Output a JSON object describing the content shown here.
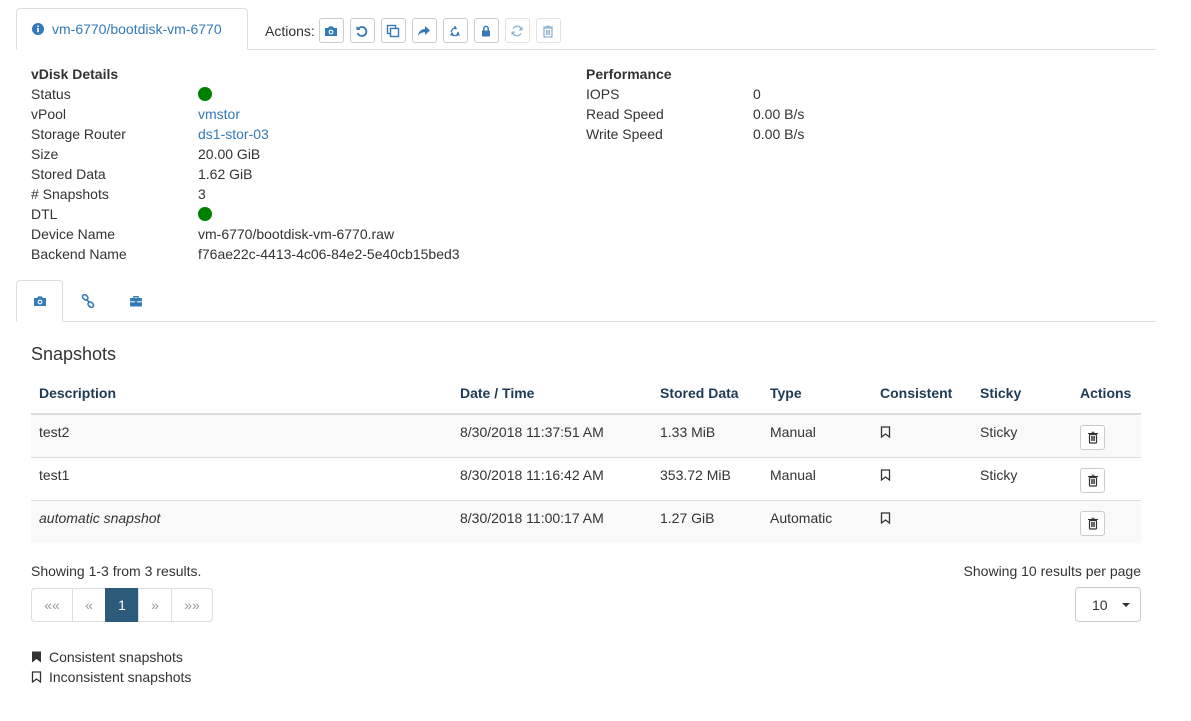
{
  "header": {
    "tab_title": "vm-6770/bootdisk-vm-6770",
    "actions_label": "Actions:",
    "action_icons": [
      "camera-icon",
      "rollback-icon",
      "clone-icon",
      "share-icon",
      "recycle-icon",
      "lock-icon",
      "refresh-icon",
      "trash-icon"
    ]
  },
  "details": {
    "heading": "vDisk Details",
    "status_label": "Status",
    "vpool_label": "vPool",
    "vpool": "vmstor",
    "router_label": "Storage Router",
    "router": "ds1-stor-03",
    "size_label": "Size",
    "size": "20.00 GiB",
    "stored_label": "Stored Data",
    "stored": "1.62 GiB",
    "snapshots_label": "# Snapshots",
    "snapshots": "3",
    "dtl_label": "DTL",
    "device_label": "Device Name",
    "device": "vm-6770/bootdisk-vm-6770.raw",
    "backend_label": "Backend Name",
    "backend": "f76ae22c-4413-4c06-84e2-5e40cb15bed3",
    "status_color": "#008000",
    "dtl_color": "#008000"
  },
  "performance": {
    "heading": "Performance",
    "iops_label": "IOPS",
    "iops": "0",
    "read_label": "Read Speed",
    "read": "0.00 B/s",
    "write_label": "Write Speed",
    "write": "0.00 B/s"
  },
  "subtabs": [
    "camera-icon",
    "link-icon",
    "briefcase-icon"
  ],
  "snapshots": {
    "title": "Snapshots",
    "columns": [
      "Description",
      "Date / Time",
      "Stored Data",
      "Type",
      "Consistent",
      "Sticky",
      "Actions"
    ],
    "rows": [
      {
        "description": "test2",
        "datetime": "8/30/2018 11:37:51 AM",
        "stored": "1.33 MiB",
        "type": "Manual",
        "sticky": "Sticky"
      },
      {
        "description": "test1",
        "datetime": "8/30/2018 11:16:42 AM",
        "stored": "353.72 MiB",
        "type": "Manual",
        "sticky": "Sticky"
      },
      {
        "description": "automatic snapshot",
        "datetime": "8/30/2018 11:00:17 AM",
        "stored": "1.27 GiB",
        "type": "Automatic",
        "sticky": ""
      }
    ],
    "showing": "Showing 1-3 from 3 results.",
    "per_page_text": "Showing 10 results per page",
    "pager": {
      "first": "««",
      "prev": "«",
      "page": "1",
      "next": "»",
      "last": "»»"
    },
    "per_page_value": "10"
  },
  "legend": {
    "consistent": "Consistent snapshots",
    "inconsistent": "Inconsistent snapshots"
  },
  "colors": {
    "link": "#337ab7",
    "active_page": "#2c5a7a",
    "status_ok": "#008000"
  }
}
